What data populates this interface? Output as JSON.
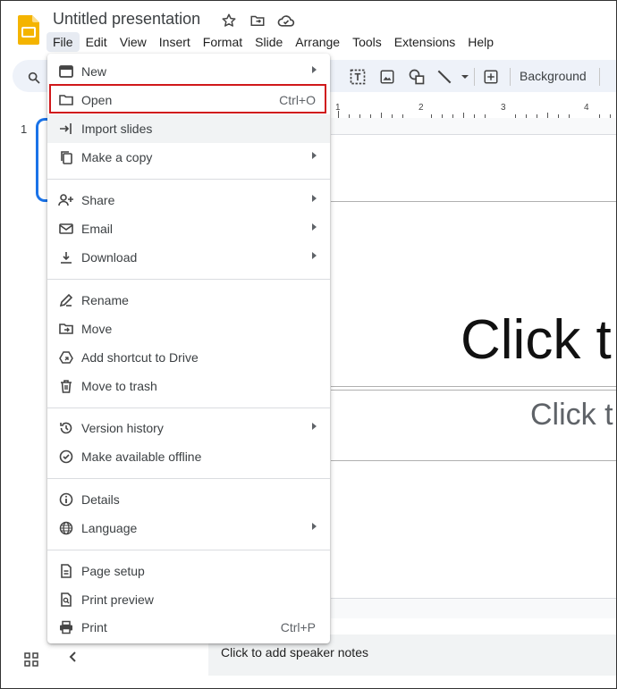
{
  "app": {
    "title": "Untitled presentation",
    "brand_color": "#f4b400"
  },
  "menubar": [
    "File",
    "Edit",
    "View",
    "Insert",
    "Format",
    "Slide",
    "Arrange",
    "Tools",
    "Extensions",
    "Help"
  ],
  "toolbar": {
    "background_label": "Background",
    "icons": [
      "search-icon",
      "text-box-icon",
      "image-icon",
      "shape-icon",
      "line-icon",
      "chevron-down-icon",
      "add-comment-icon"
    ]
  },
  "ruler": {
    "marks": [
      "1",
      "2",
      "3",
      "4"
    ]
  },
  "slides_panel": {
    "current_slide_number": "1"
  },
  "slide": {
    "title_placeholder": "Click t",
    "subtitle_placeholder": "Click t"
  },
  "notes": {
    "placeholder": "Click to add speaker notes"
  },
  "file_menu": {
    "items": [
      {
        "label": "New",
        "icon": "slides-icon",
        "submenu": true
      },
      {
        "label": "Open",
        "icon": "folder-icon",
        "shortcut": "Ctrl+O",
        "highlighted": true
      },
      {
        "label": "Import slides",
        "icon": "import-icon",
        "hover": true
      },
      {
        "label": "Make a copy",
        "icon": "copy-icon",
        "submenu": true
      },
      {
        "label": "Share",
        "icon": "person-add-icon",
        "submenu": true
      },
      {
        "label": "Email",
        "icon": "email-icon",
        "submenu": true
      },
      {
        "label": "Download",
        "icon": "download-icon",
        "submenu": true
      },
      {
        "label": "Rename",
        "icon": "pencil-icon"
      },
      {
        "label": "Move",
        "icon": "move-folder-icon"
      },
      {
        "label": "Add shortcut to Drive",
        "icon": "drive-shortcut-icon"
      },
      {
        "label": "Move to trash",
        "icon": "trash-icon"
      },
      {
        "label": "Version history",
        "icon": "history-icon",
        "submenu": true
      },
      {
        "label": "Make available offline",
        "icon": "offline-icon"
      },
      {
        "label": "Details",
        "icon": "info-icon"
      },
      {
        "label": "Language",
        "icon": "globe-icon",
        "submenu": true
      },
      {
        "label": "Page setup",
        "icon": "page-icon"
      },
      {
        "label": "Print preview",
        "icon": "print-preview-icon"
      },
      {
        "label": "Print",
        "icon": "print-icon",
        "shortcut": "Ctrl+P"
      }
    ],
    "highlight_color": "#d0181b"
  }
}
